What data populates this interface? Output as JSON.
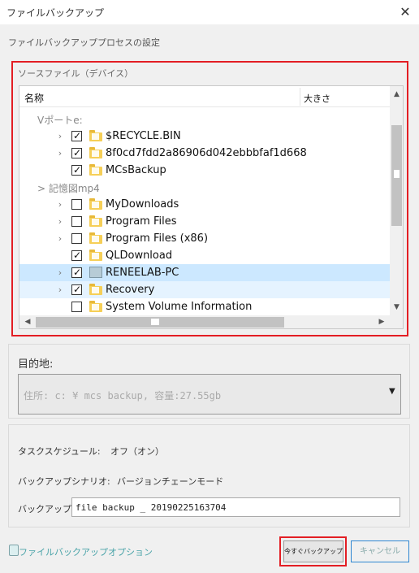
{
  "window": {
    "title": "ファイルバックアップ",
    "close_glyph": "✕"
  },
  "section_caption": "ファイルバックアッププロセスの設定",
  "source": {
    "label": "ソースファイル（デバイス）",
    "columns": {
      "name": "名称",
      "size": "大きさ"
    },
    "tree": [
      {
        "kind": "group",
        "label": "Vポートe:"
      },
      {
        "label": "$RECYCLE.BIN",
        "checked": true,
        "expandable": true,
        "icon": "folder-icon"
      },
      {
        "label": "8f0cd7fdd2a86906d042ebbbfaf1d668",
        "checked": true,
        "expandable": true,
        "icon": "folder-icon"
      },
      {
        "label": "MCsBackup",
        "checked": true,
        "expandable": false,
        "icon": "folder-icon"
      },
      {
        "kind": "group",
        "label": "> 記憶図mp4"
      },
      {
        "label": "MyDownloads",
        "checked": false,
        "expandable": true,
        "icon": "folder-icon"
      },
      {
        "label": "Program Files",
        "checked": false,
        "expandable": true,
        "icon": "folder-icon"
      },
      {
        "label": "Program Files (x86)",
        "checked": false,
        "expandable": true,
        "icon": "folder-icon"
      },
      {
        "label": "QLDownload",
        "checked": true,
        "expandable": false,
        "icon": "folder-icon"
      },
      {
        "label": "RENEELAB-PC",
        "checked": true,
        "expandable": true,
        "icon": "computer-icon",
        "state": "selected"
      },
      {
        "label": "Recovery",
        "checked": true,
        "expandable": true,
        "icon": "folder-icon",
        "state": "hover"
      },
      {
        "label": "System Volume Information",
        "checked": false,
        "expandable": false,
        "icon": "folder-icon"
      }
    ]
  },
  "destination": {
    "label": "目的地:",
    "value": "住所: c: ¥ mcs backup, 容量:27.55gb",
    "arrow": "▼"
  },
  "settings": {
    "schedule_label": "タスクスケジュール:",
    "schedule_value": "オフ（オン）",
    "scenario_label": "バックアップシナリオ:",
    "scenario_value": "バージョンチェーンモード",
    "name_label": "バックアップ名:",
    "name_value": "file backup _ 20190225163704"
  },
  "footer": {
    "options_link": "ファイルバックアップオプション",
    "start_button": "今すぐバックアップ",
    "cancel_button": "キャンセル"
  },
  "colors": {
    "highlight_red": "#e31e24",
    "selected_row": "#cce8ff",
    "hover_row": "#e5f3ff",
    "link_teal": "#49a3a8",
    "folder_yellow": "#f6cf57"
  }
}
